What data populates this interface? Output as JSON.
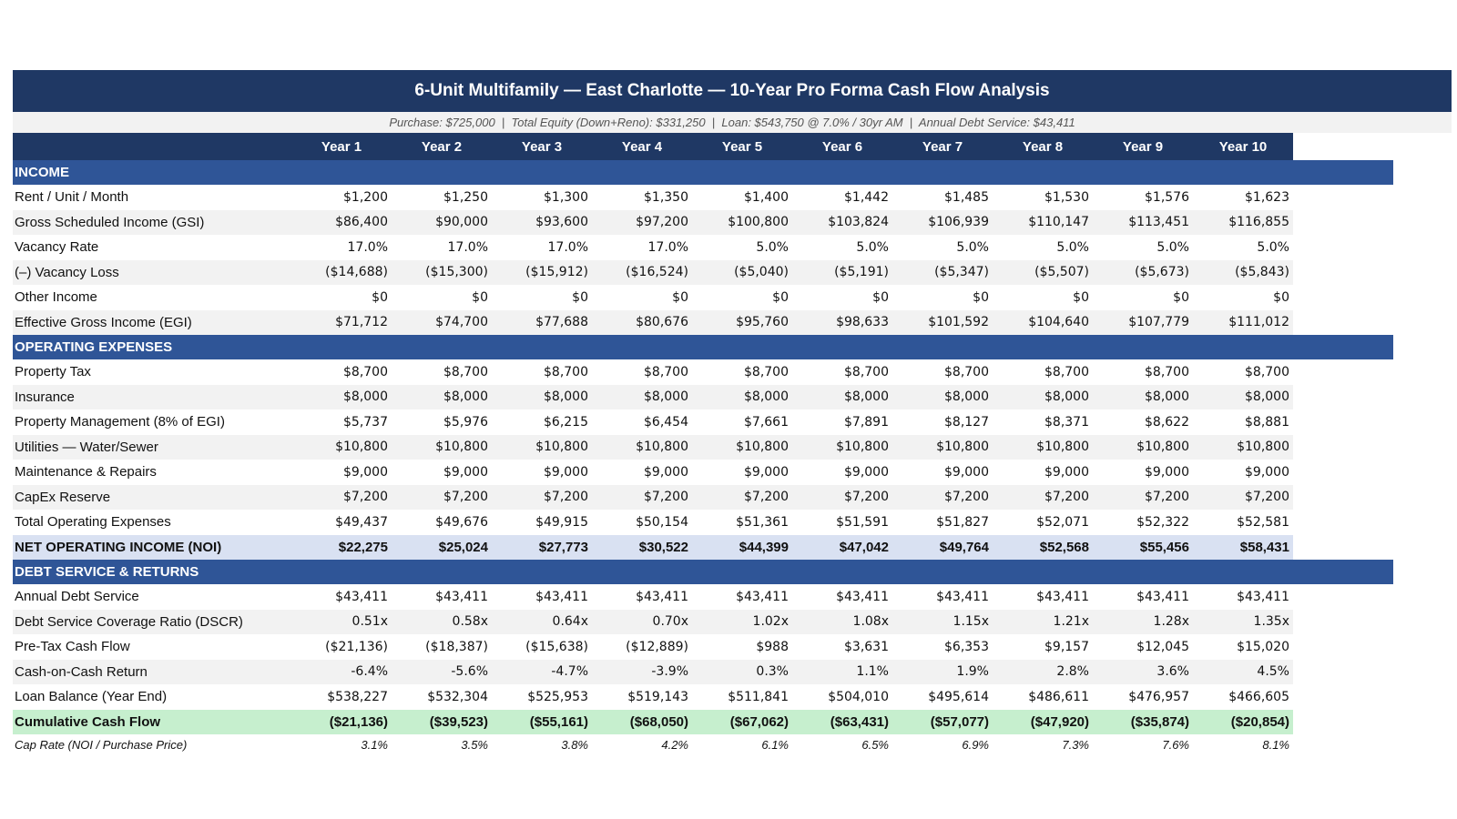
{
  "title": "6-Unit Multifamily — East Charlotte — 10-Year Pro Forma Cash Flow Analysis",
  "subtitle": "Purchase: $725,000  |  Total Equity (Down+Reno): $331,250  |  Loan: $543,750 @ 7.0% / 30yr AM  |  Annual Debt Service: $43,411",
  "years": [
    "Year 1",
    "Year 2",
    "Year 3",
    "Year 4",
    "Year 5",
    "Year 6",
    "Year 7",
    "Year 8",
    "Year 9",
    "Year 10"
  ],
  "sections": [
    {
      "title": "INCOME",
      "rows": [
        {
          "label": "Rent / Unit / Month",
          "values": [
            "$1,200",
            "$1,250",
            "$1,300",
            "$1,350",
            "$1,400",
            "$1,442",
            "$1,485",
            "$1,530",
            "$1,576",
            "$1,623"
          ]
        },
        {
          "label": "Gross Scheduled Income (GSI)",
          "values": [
            "$86,400",
            "$90,000",
            "$93,600",
            "$97,200",
            "$100,800",
            "$103,824",
            "$106,939",
            "$110,147",
            "$113,451",
            "$116,855"
          ]
        },
        {
          "label": "Vacancy Rate",
          "values": [
            "17.0%",
            "17.0%",
            "17.0%",
            "17.0%",
            "5.0%",
            "5.0%",
            "5.0%",
            "5.0%",
            "5.0%",
            "5.0%"
          ]
        },
        {
          "label": "(–) Vacancy Loss",
          "values": [
            "($14,688)",
            "($15,300)",
            "($15,912)",
            "($16,524)",
            "($5,040)",
            "($5,191)",
            "($5,347)",
            "($5,507)",
            "($5,673)",
            "($5,843)"
          ]
        },
        {
          "label": "Other Income",
          "values": [
            "$0",
            "$0",
            "$0",
            "$0",
            "$0",
            "$0",
            "$0",
            "$0",
            "$0",
            "$0"
          ]
        },
        {
          "label": "Effective Gross Income (EGI)",
          "values": [
            "$71,712",
            "$74,700",
            "$77,688",
            "$80,676",
            "$95,760",
            "$98,633",
            "$101,592",
            "$104,640",
            "$107,779",
            "$111,012"
          ]
        }
      ]
    },
    {
      "title": "OPERATING EXPENSES",
      "rows": [
        {
          "label": "Property Tax",
          "values": [
            "$8,700",
            "$8,700",
            "$8,700",
            "$8,700",
            "$8,700",
            "$8,700",
            "$8,700",
            "$8,700",
            "$8,700",
            "$8,700"
          ]
        },
        {
          "label": "Insurance",
          "values": [
            "$8,000",
            "$8,000",
            "$8,000",
            "$8,000",
            "$8,000",
            "$8,000",
            "$8,000",
            "$8,000",
            "$8,000",
            "$8,000"
          ]
        },
        {
          "label": "Property Management (8% of EGI)",
          "values": [
            "$5,737",
            "$5,976",
            "$6,215",
            "$6,454",
            "$7,661",
            "$7,891",
            "$8,127",
            "$8,371",
            "$8,622",
            "$8,881"
          ]
        },
        {
          "label": "Utilities — Water/Sewer",
          "values": [
            "$10,800",
            "$10,800",
            "$10,800",
            "$10,800",
            "$10,800",
            "$10,800",
            "$10,800",
            "$10,800",
            "$10,800",
            "$10,800"
          ]
        },
        {
          "label": "Maintenance & Repairs",
          "values": [
            "$9,000",
            "$9,000",
            "$9,000",
            "$9,000",
            "$9,000",
            "$9,000",
            "$9,000",
            "$9,000",
            "$9,000",
            "$9,000"
          ]
        },
        {
          "label": "CapEx Reserve",
          "values": [
            "$7,200",
            "$7,200",
            "$7,200",
            "$7,200",
            "$7,200",
            "$7,200",
            "$7,200",
            "$7,200",
            "$7,200",
            "$7,200"
          ]
        },
        {
          "label": "Total Operating Expenses",
          "values": [
            "$49,437",
            "$49,676",
            "$49,915",
            "$50,154",
            "$51,361",
            "$51,591",
            "$51,827",
            "$52,071",
            "$52,322",
            "$52,581"
          ]
        }
      ]
    }
  ],
  "noi": {
    "label": "NET OPERATING INCOME (NOI)",
    "values": [
      "$22,275",
      "$25,024",
      "$27,773",
      "$30,522",
      "$44,399",
      "$47,042",
      "$49,764",
      "$52,568",
      "$55,456",
      "$58,431"
    ]
  },
  "debt_section": {
    "title": "DEBT SERVICE & RETURNS",
    "rows": [
      {
        "label": "Annual Debt Service",
        "values": [
          "$43,411",
          "$43,411",
          "$43,411",
          "$43,411",
          "$43,411",
          "$43,411",
          "$43,411",
          "$43,411",
          "$43,411",
          "$43,411"
        ]
      },
      {
        "label": "Debt Service Coverage Ratio (DSCR)",
        "values": [
          "0.51x",
          "0.58x",
          "0.64x",
          "0.70x",
          "1.02x",
          "1.08x",
          "1.15x",
          "1.21x",
          "1.28x",
          "1.35x"
        ]
      },
      {
        "label": "Pre-Tax Cash Flow",
        "values": [
          "($21,136)",
          "($18,387)",
          "($15,638)",
          "($12,889)",
          "$988",
          "$3,631",
          "$6,353",
          "$9,157",
          "$12,045",
          "$15,020"
        ]
      },
      {
        "label": "Cash-on-Cash Return",
        "values": [
          "-6.4%",
          "-5.6%",
          "-4.7%",
          "-3.9%",
          "0.3%",
          "1.1%",
          "1.9%",
          "2.8%",
          "3.6%",
          "4.5%"
        ]
      },
      {
        "label": "Loan Balance (Year End)",
        "values": [
          "$538,227",
          "$532,304",
          "$525,953",
          "$519,143",
          "$511,841",
          "$504,010",
          "$495,614",
          "$486,611",
          "$476,957",
          "$466,605"
        ]
      }
    ]
  },
  "cumulative": {
    "label": "Cumulative Cash Flow",
    "values": [
      "($21,136)",
      "($39,523)",
      "($55,161)",
      "($68,050)",
      "($67,062)",
      "($63,431)",
      "($57,077)",
      "($47,920)",
      "($35,874)",
      "($20,854)"
    ]
  },
  "cap_rate": {
    "label": "Cap Rate (NOI / Purchase Price)",
    "values": [
      "3.1%",
      "3.5%",
      "3.8%",
      "4.2%",
      "6.1%",
      "6.5%",
      "6.9%",
      "7.3%",
      "7.6%",
      "8.1%"
    ]
  }
}
